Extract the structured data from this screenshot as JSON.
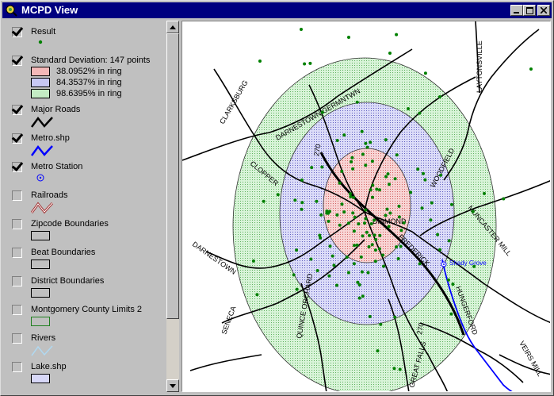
{
  "window": {
    "title": "MCPD View"
  },
  "legend": {
    "themes": [
      {
        "name": "Result",
        "checked": true,
        "symbol": "green-point"
      },
      {
        "name": "Standard Deviation:  147 points",
        "checked": true,
        "symbol": "rings",
        "classes": [
          {
            "label": "38.0952% in ring",
            "color": "#f4b8b8"
          },
          {
            "label": "84.3537% in ring",
            "color": "#c8c8f4"
          },
          {
            "label": "98.6395% in ring",
            "color": "#c4ecc4"
          }
        ]
      },
      {
        "name": "Major Roads",
        "checked": true,
        "symbol": "black-line"
      },
      {
        "name": "Metro.shp",
        "checked": true,
        "symbol": "blue-line"
      },
      {
        "name": "Metro Station",
        "checked": true,
        "symbol": "blue-circle"
      },
      {
        "name": "Railroads",
        "checked": false,
        "symbol": "red-railroad"
      },
      {
        "name": "Zipcode Boundaries",
        "checked": false,
        "symbol": "box"
      },
      {
        "name": "Beat Boundaries",
        "checked": false,
        "symbol": "box"
      },
      {
        "name": "District Boundaries",
        "checked": false,
        "symbol": "box"
      },
      {
        "name": "Montgomery County Limits 2",
        "checked": false,
        "symbol": "green-box"
      },
      {
        "name": "Rivers",
        "checked": false,
        "symbol": "light-blue-line"
      },
      {
        "name": "Lake.shp",
        "checked": false,
        "symbol": "lavender-box"
      }
    ]
  },
  "map": {
    "road_labels": [
      "LAYTONSVILLE",
      "CLARKSBURG",
      "DARNESTOWN GERMNTWN",
      "270",
      "CLOPPER",
      "WOODFIELD",
      "MUNCASTER MILL",
      "DIAMOND",
      "FREDERICK",
      "DARNESTOWN",
      "QUINCE ORCHARD",
      "SENECA",
      "HUNGERFORD",
      "270",
      "GREAT FALLS",
      "VEIRS MILL"
    ],
    "station_label": "Shady Grove"
  },
  "colors": {
    "inner_ring": "#f4b8b8",
    "middle_ring": "#c8c8f4",
    "outer_ring": "#c4ecc4",
    "points": "#008000",
    "metro": "#0000ff",
    "titlebar": "#000080"
  }
}
